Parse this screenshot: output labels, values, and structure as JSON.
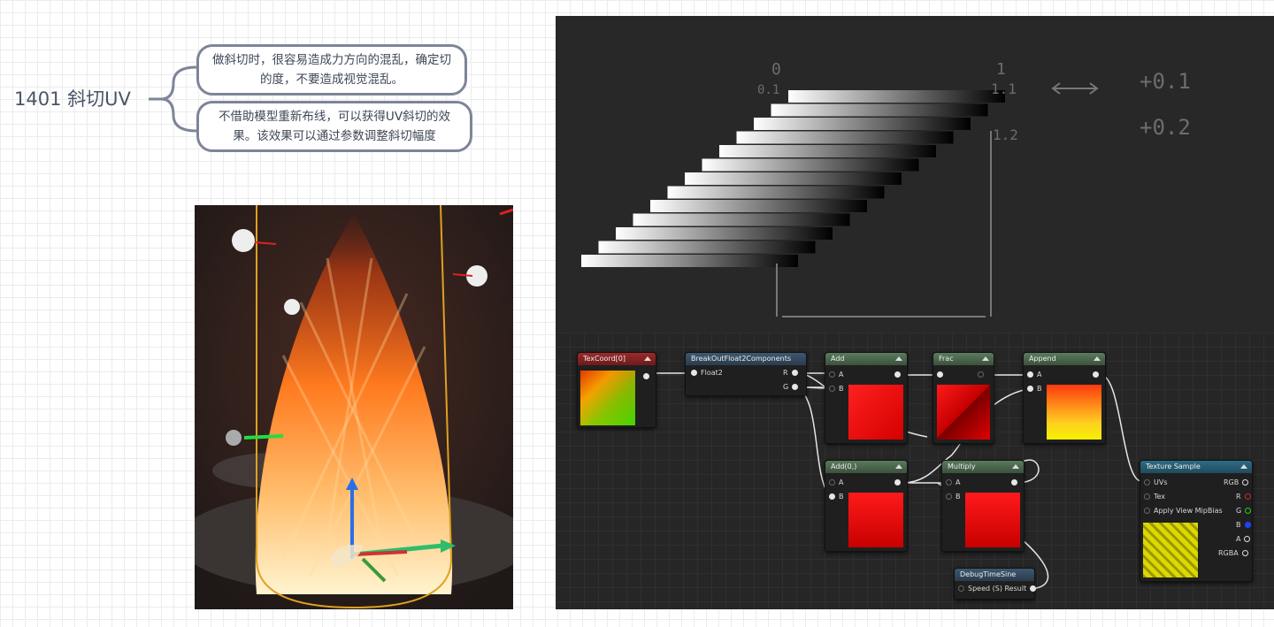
{
  "mindmap": {
    "root_label": "1401 斜切UV",
    "bubble1": "做斜切时，很容易造成力方向的混乱，确定切的度，不要造成视觉混乱。",
    "bubble2": "不借助模型重新布线，可以获得UV斜切的效果。该效果可以通过参数调整斜切幅度"
  },
  "chalkboard": {
    "n0": "0",
    "n01": "0.1",
    "n1": "1",
    "n11": "1.1",
    "n12": "1.2",
    "plus1": "+0.1",
    "plus2": "+0.2"
  },
  "nodes": {
    "texcoord": {
      "title": "TexCoord[0]"
    },
    "breakout": {
      "title": "BreakOutFloat2Components",
      "in": "Float2",
      "r": "R",
      "g": "G"
    },
    "add": {
      "title": "Add",
      "a": "A",
      "b": "B"
    },
    "frac": {
      "title": "Frac"
    },
    "append": {
      "title": "Append",
      "a": "A",
      "b": "B"
    },
    "add0": {
      "title": "Add(0,)",
      "a": "A",
      "b": "B"
    },
    "multiply": {
      "title": "Multiply",
      "a": "A",
      "b": "B"
    },
    "debug": {
      "title": "DebugTimeSine",
      "pin": "Speed (S) Result"
    },
    "texsample": {
      "title": "Texture Sample",
      "uvs": "UVs",
      "tex": "Tex",
      "mip": "Apply View MipBias",
      "rgb": "RGB",
      "r": "R",
      "g": "G",
      "b": "B",
      "a": "A",
      "rgba": "RGBA"
    }
  },
  "colors": {
    "bubble_border": "#7d8597",
    "node_red": "#9c2a2a",
    "node_blue": "#3d5870",
    "node_green": "#5b7a5d",
    "node_teal": "#2e6c86",
    "fire": "#ff7a1e"
  }
}
